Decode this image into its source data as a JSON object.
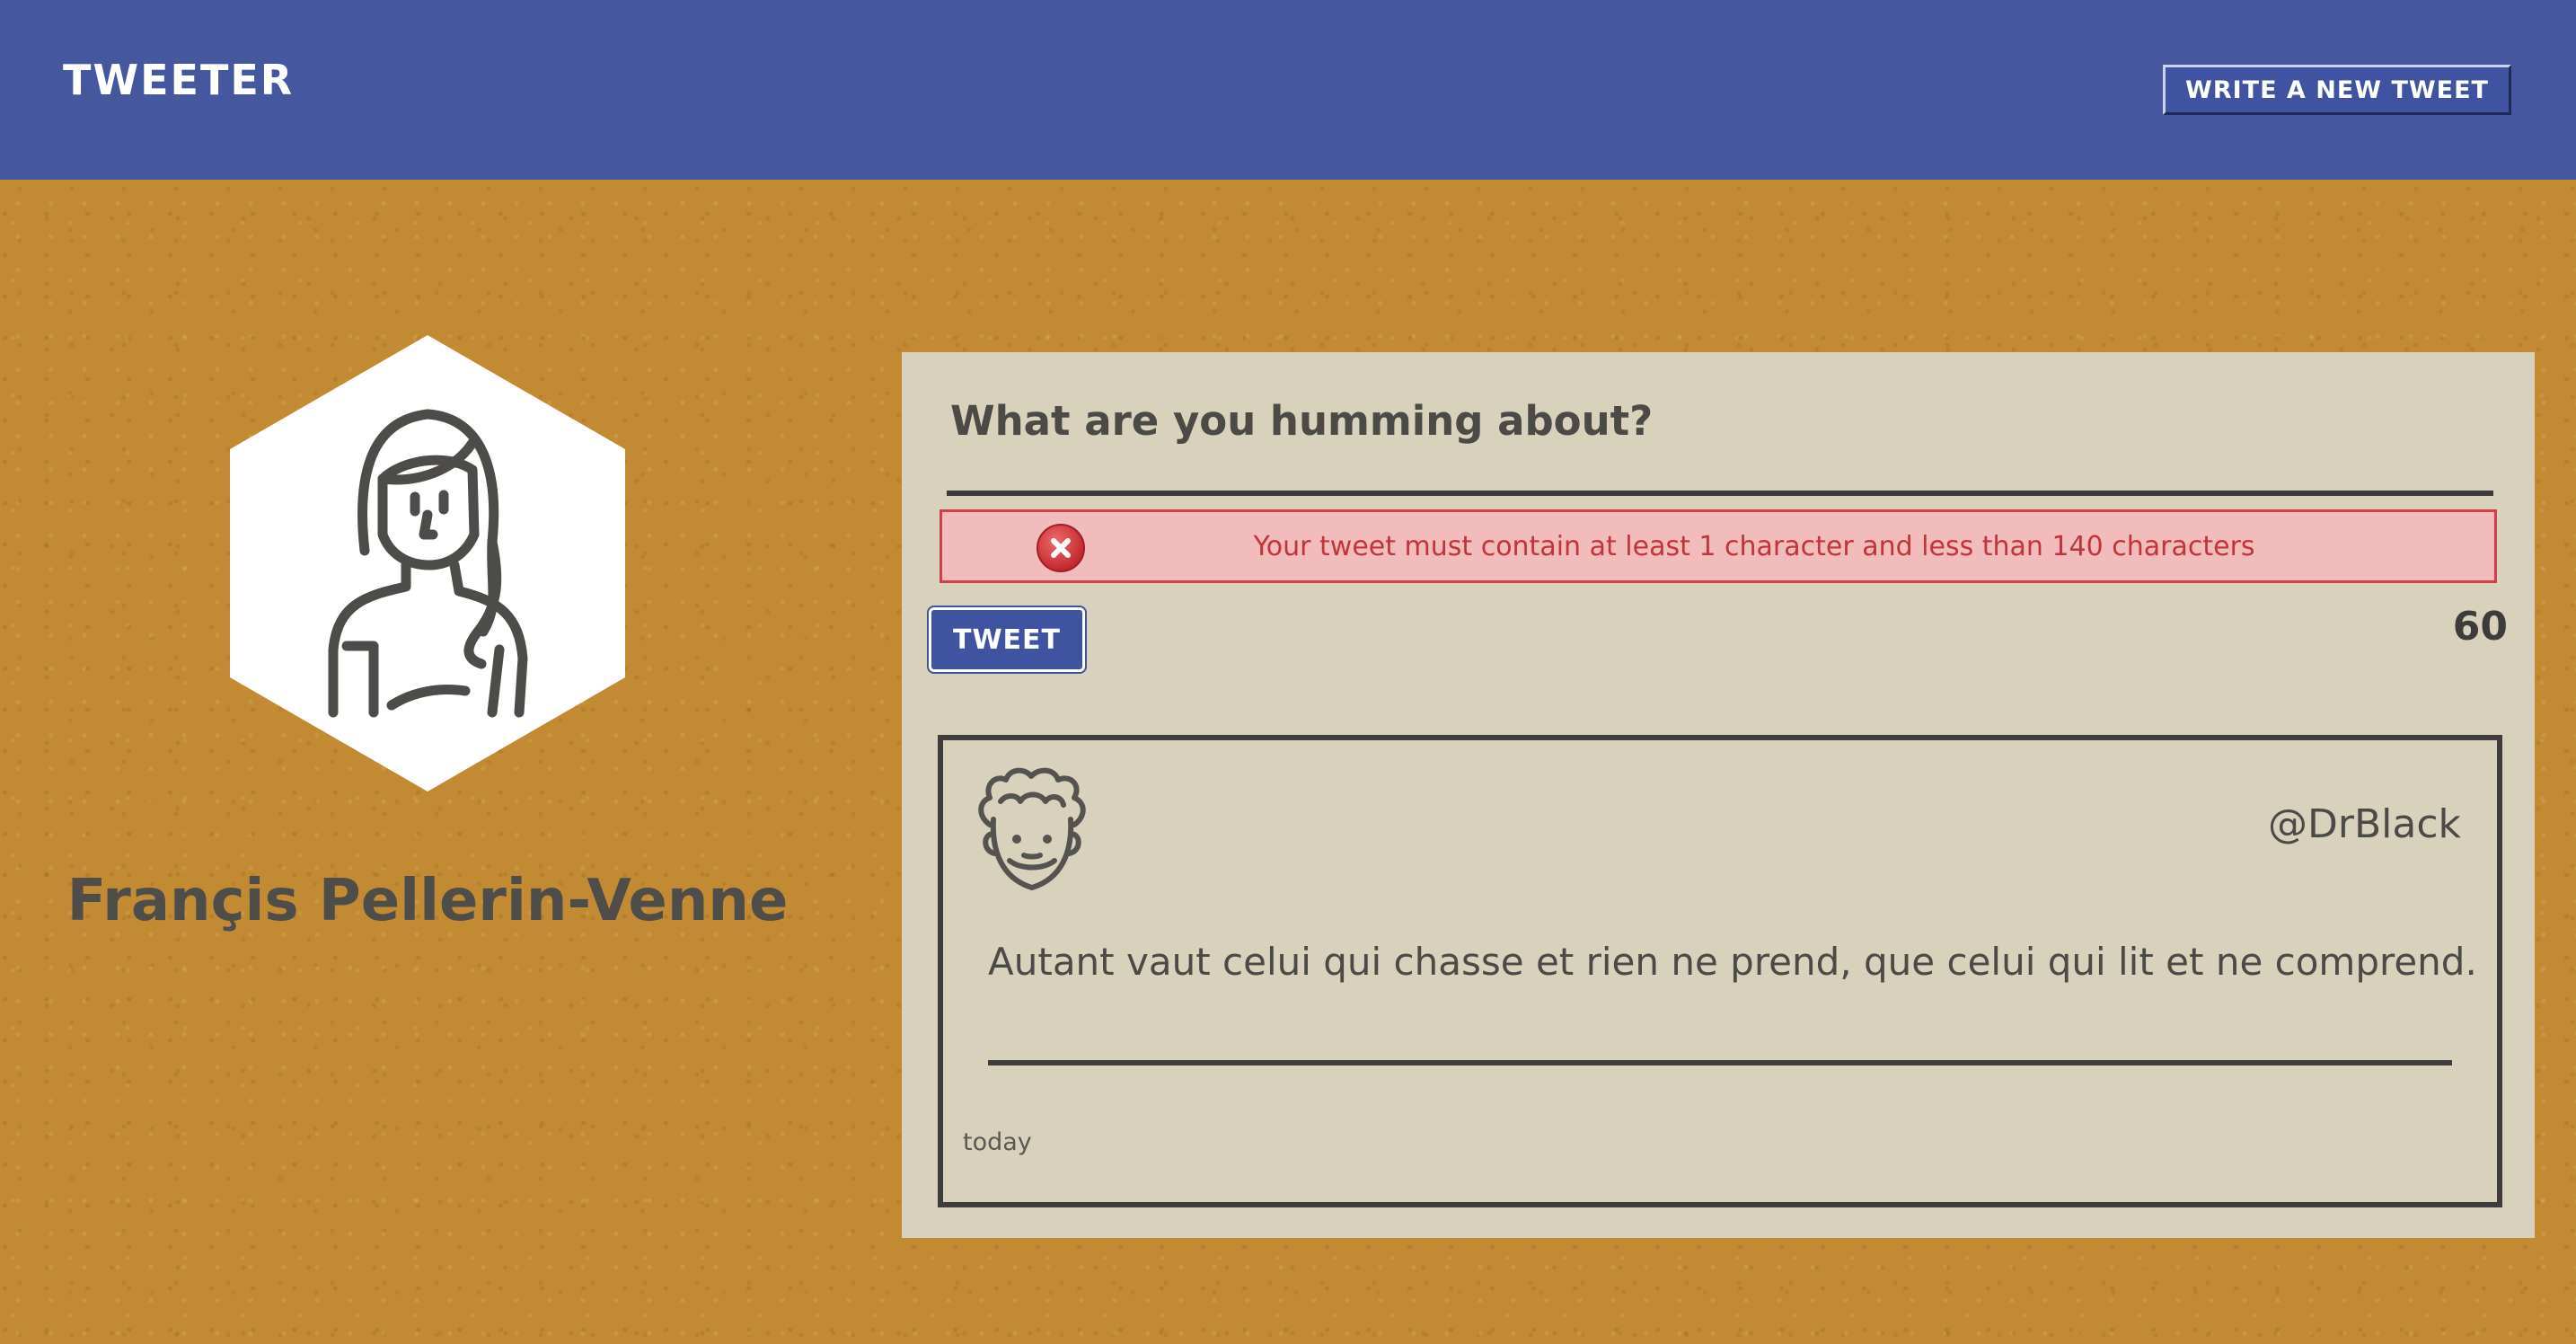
{
  "header": {
    "app_title": "TWEETER",
    "compose_button_label": "WRITE A NEW TWEET"
  },
  "profile": {
    "name": "Françis Pellerin-Venne",
    "avatar_icon": "woman-avatar-icon"
  },
  "composer": {
    "prompt": "What are you humming about?",
    "input_value": "",
    "error_message": "Your tweet must contain at least 1 character and less than 140 characters",
    "error_icon": "error-x-circle-icon",
    "tweet_button_label": "TWEET",
    "char_counter": "60"
  },
  "tweets": [
    {
      "handle": "@DrBlack",
      "avatar_icon": "curly-hair-man-avatar-icon",
      "content": "Autant vaut celui qui chasse et rien ne prend, que celui qui lit et ne comprend.",
      "timestamp": "today"
    }
  ],
  "colors": {
    "header_bg": "#44579f",
    "page_bg": "#c28b33",
    "panel_bg": "#d8d1bb",
    "error_bg": "#f3bcbc",
    "error_text": "#c0353a",
    "text": "#4c4a47"
  }
}
